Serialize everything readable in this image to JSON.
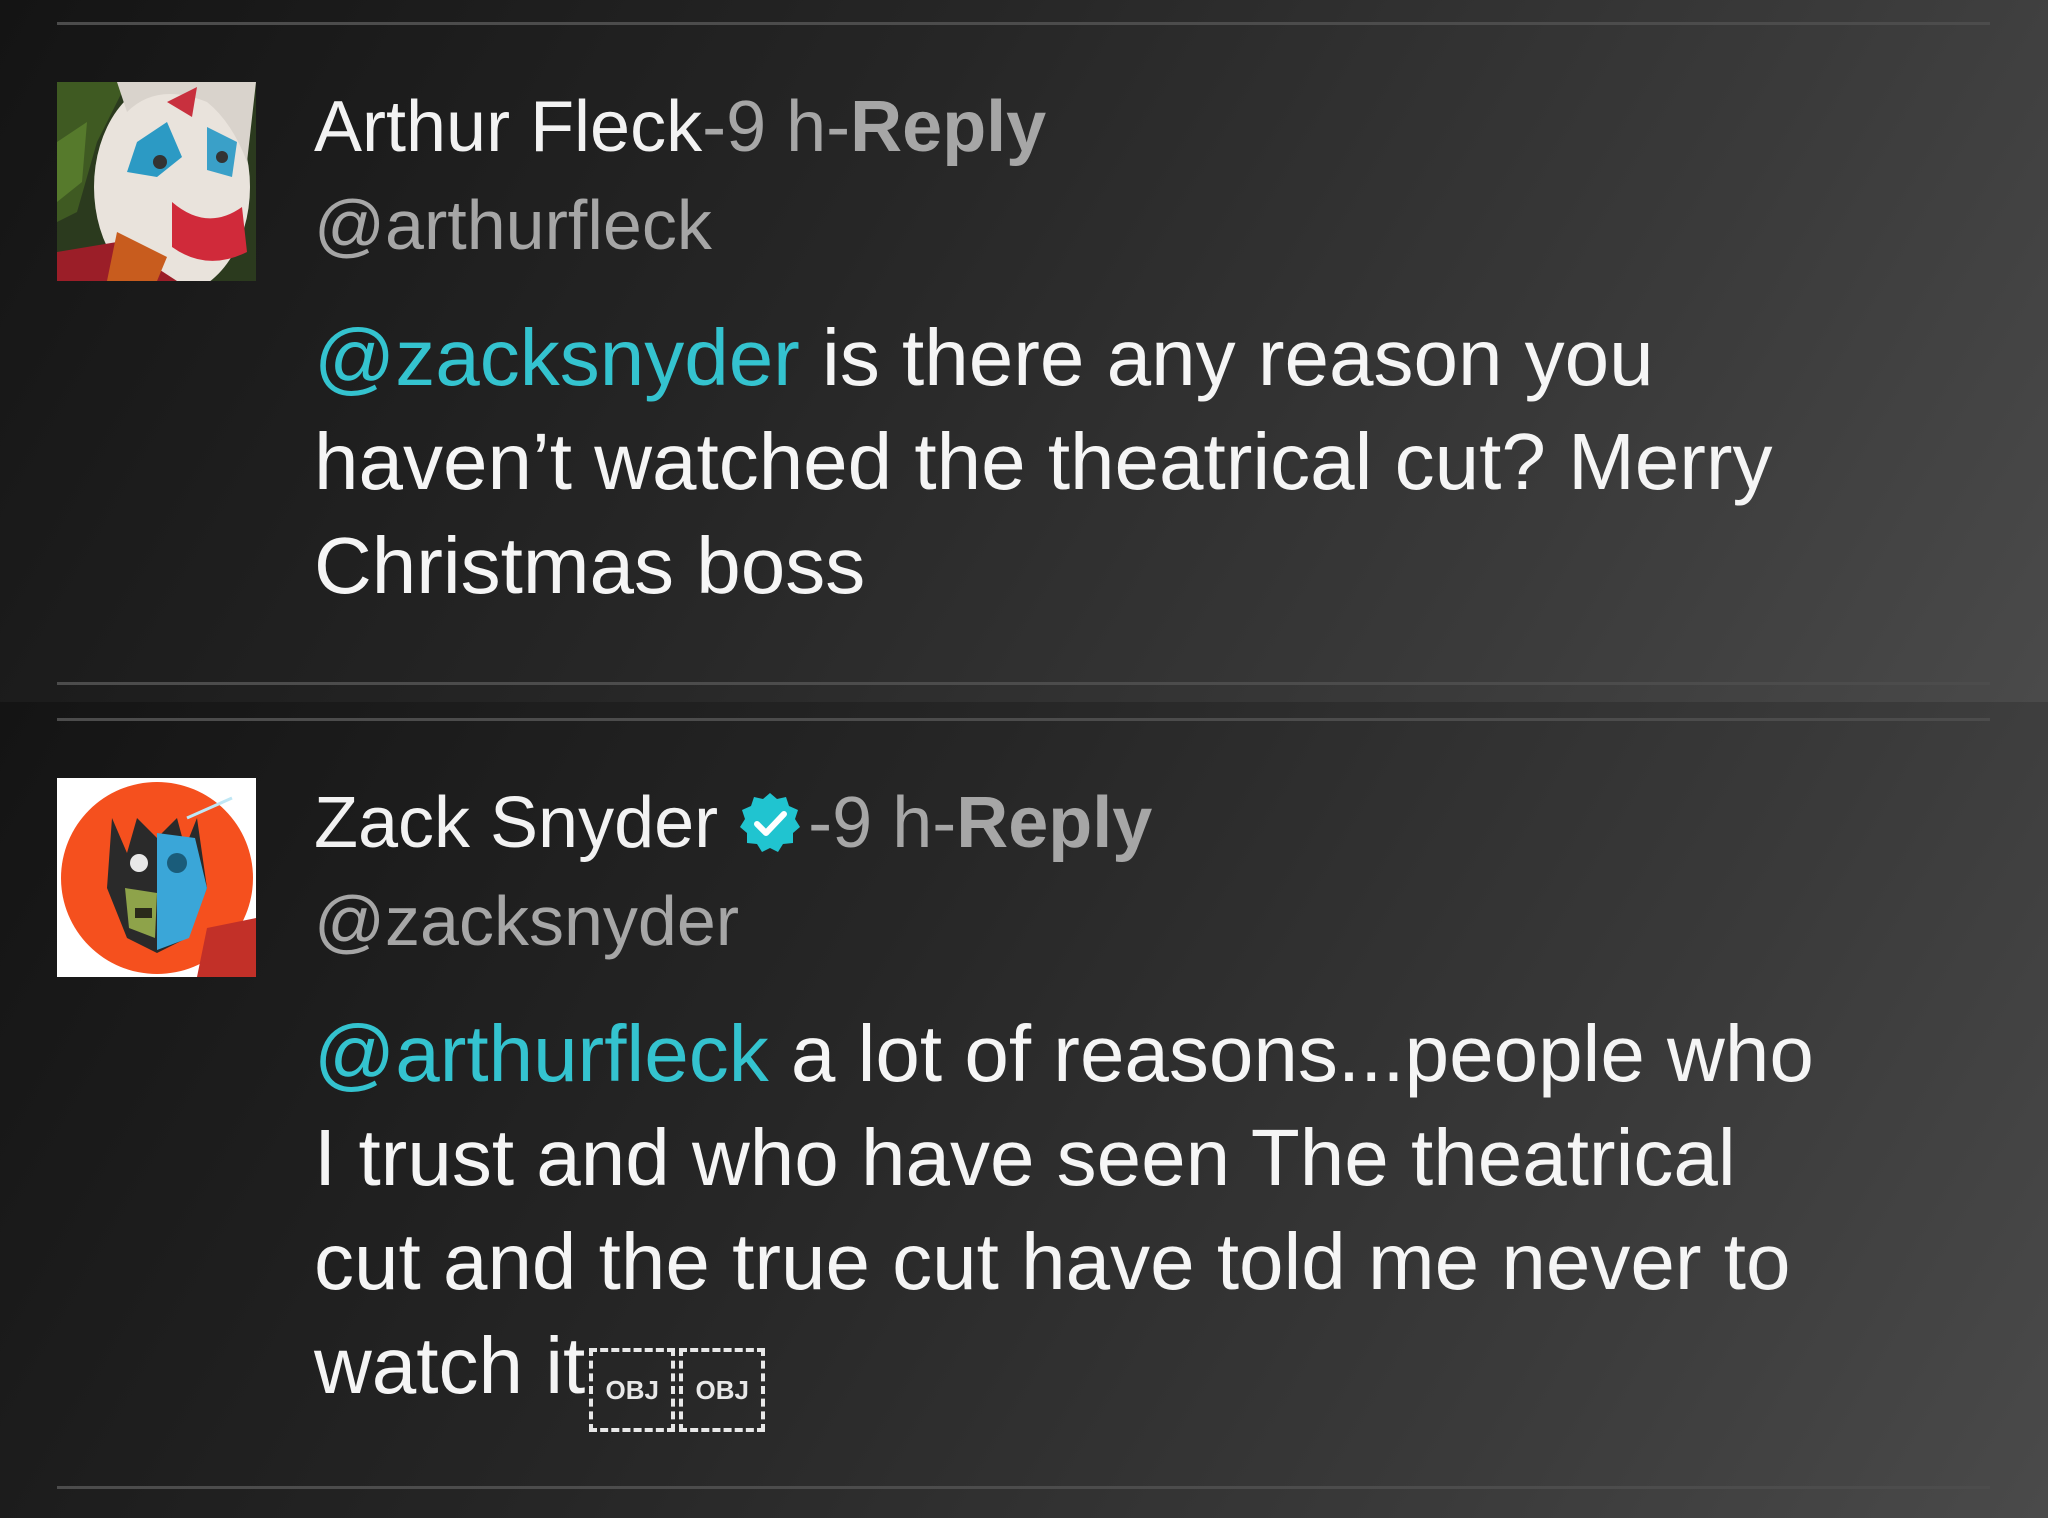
{
  "comments": [
    {
      "author": "Arthur Fleck",
      "separator": " - ",
      "time": "9 h",
      "reply_label": "Reply",
      "handle": "@arthurfleck",
      "avatar_icon": "joker-avatar-icon",
      "verified": false,
      "body_lines": [
        {
          "mention": "@zacksnyder",
          "text": "  is there any reason you"
        },
        {
          "text": "haven’t watched the theatrical cut? Merry"
        },
        {
          "text": "Christmas boss"
        }
      ]
    },
    {
      "author": "Zack Snyder",
      "separator": " - ",
      "time": "9 h",
      "reply_label": "Reply",
      "handle": "@zacksnyder",
      "avatar_icon": "batman-zombie-avatar-icon",
      "verified": true,
      "verified_icon": "verified-badge-icon",
      "body_lines": [
        {
          "mention": "@arthurfleck",
          "text": " a lot of reasons...people who"
        },
        {
          "text": "I trust and who have seen The theatrical"
        },
        {
          "text": "cut and the true cut have told me never to"
        },
        {
          "text": "watch it"
        }
      ],
      "trailing_objects": [
        "OBJ",
        "OBJ"
      ]
    }
  ],
  "colors": {
    "mention": "#34c3cf",
    "verified_badge": "#20c4d0",
    "text_primary": "#f2f2f2",
    "text_secondary": "#a6a6a6",
    "background": "#2a2a2a"
  }
}
